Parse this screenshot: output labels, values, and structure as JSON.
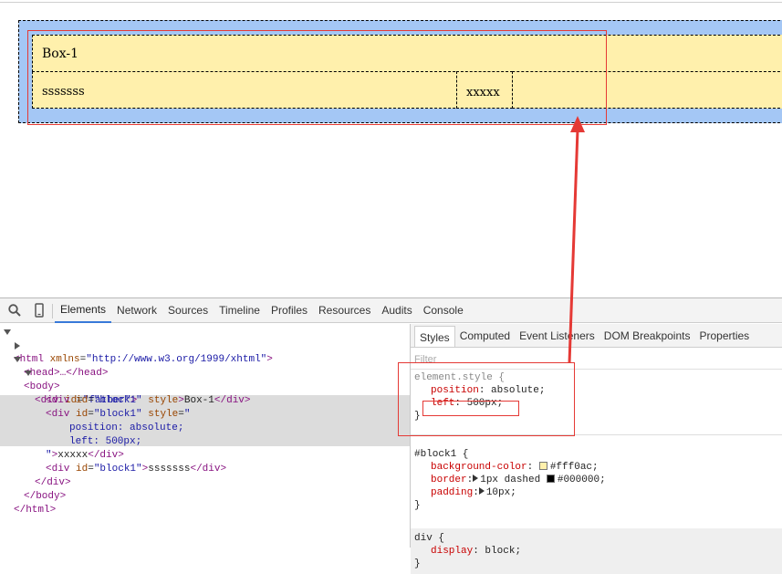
{
  "page": {
    "box1_text": "Box-1",
    "box2_text": "xxxxx",
    "box3_text": "sssssss"
  },
  "toolbar": {
    "icons": [
      "search-icon",
      "device-mode-icon"
    ],
    "tabs": [
      "Elements",
      "Network",
      "Sources",
      "Timeline",
      "Profiles",
      "Resources",
      "Audits",
      "Console"
    ],
    "active_tab": "Elements"
  },
  "dom": {
    "html_tag_open": "<html",
    "html_attr": "xmlns",
    "html_val": "\"http://www.w3.org/1999/xhtml\"",
    "html_close": ">",
    "head": "<head>…</head>",
    "body_open": "<body>",
    "father_open": "<div",
    "father_attr": "id",
    "father_val": "\"father\"",
    "father_gt": ">",
    "b1_open": "<div",
    "b1_attr": "id",
    "b1_val": "\"block1\"",
    "b1_attr2": "style",
    "b1_text": "Box-1",
    "b1_close": "</div>",
    "b2_open": "<div",
    "b2_attr": "id",
    "b2_val": "\"block1\"",
    "b2_attr2": "style",
    "b2_val2a": "\"",
    "b2_style1": "position: absolute;",
    "b2_style2": "left: 500px;",
    "b2_val2b": "\"",
    "b2_text": "xxxxx",
    "b2_close": "</div>",
    "b3_open": "<div",
    "b3_attr": "id",
    "b3_val": "\"block1\"",
    "b3_text": "sssssss",
    "b3_close": "</div>",
    "father_close": "</div>",
    "body_close": "</body>",
    "html_end": "</html>"
  },
  "styles_tabs": {
    "tabs": [
      "Styles",
      "Computed",
      "Event Listeners",
      "DOM Breakpoints",
      "Properties"
    ],
    "active": "Styles",
    "filter_placeholder": "Filter"
  },
  "rules": {
    "element_style": {
      "selector": "element.style {",
      "decls": [
        {
          "name": "position",
          "value": "absolute"
        },
        {
          "name": "left",
          "value": "500px"
        }
      ]
    },
    "block1": {
      "selector": "#block1 {",
      "decls": [
        {
          "name": "background-color",
          "value": "#fff0ac",
          "swatch": "#fff0ac"
        },
        {
          "name": "border",
          "value": "1px dashed",
          "swatch2": "#000000",
          "value2": "#000000"
        },
        {
          "name": "padding",
          "value": "10px"
        }
      ]
    },
    "div": {
      "selector": "div {",
      "decls": [
        {
          "name": "display",
          "value": "block"
        }
      ]
    },
    "close_brace": "}"
  },
  "colors": {
    "father_bg": "#a4c7f5",
    "block_bg": "#fff0ac",
    "annotation_red": "#e53935",
    "tab_accent": "#3879d9"
  }
}
